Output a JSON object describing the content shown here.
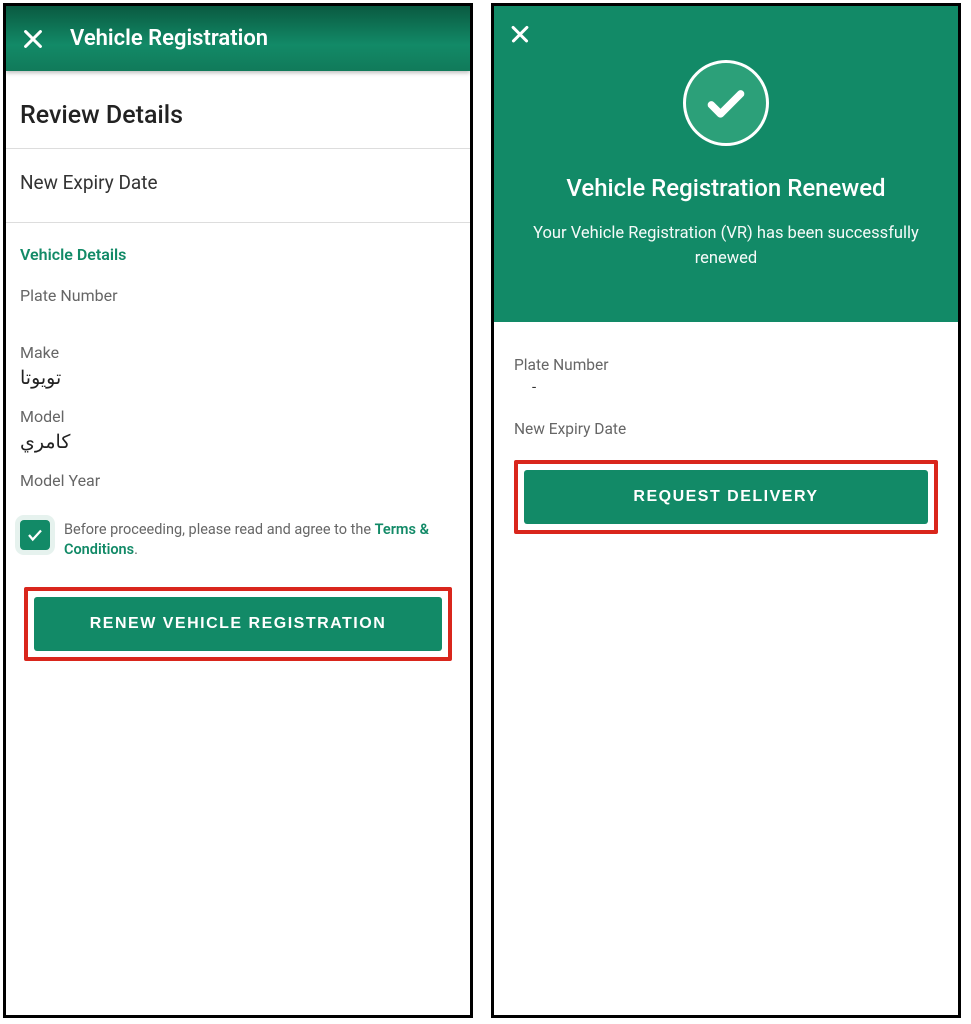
{
  "screen1": {
    "appbar_title": "Vehicle Registration",
    "review_heading": "Review Details",
    "new_expiry_label": "New Expiry Date",
    "vehicle_details_heading": "Vehicle Details",
    "fields": {
      "plate_label": "Plate Number",
      "make_label": "Make",
      "make_value": "تويوتا",
      "model_label": "Model",
      "model_value": "كامري",
      "model_year_label": "Model Year"
    },
    "consent_prefix": "Before proceeding, please read and agree to the ",
    "consent_link": "Terms & Conditions",
    "consent_suffix": ".",
    "primary_button": "RENEW VEHICLE REGISTRATION"
  },
  "screen2": {
    "hero_title": "Vehicle Registration Renewed",
    "hero_sub": "Your Vehicle Registration (VR) has been successfully renewed",
    "plate_label": "Plate Number",
    "plate_value": "-",
    "expiry_label": "New Expiry Date",
    "primary_button": "REQUEST DELIVERY"
  }
}
